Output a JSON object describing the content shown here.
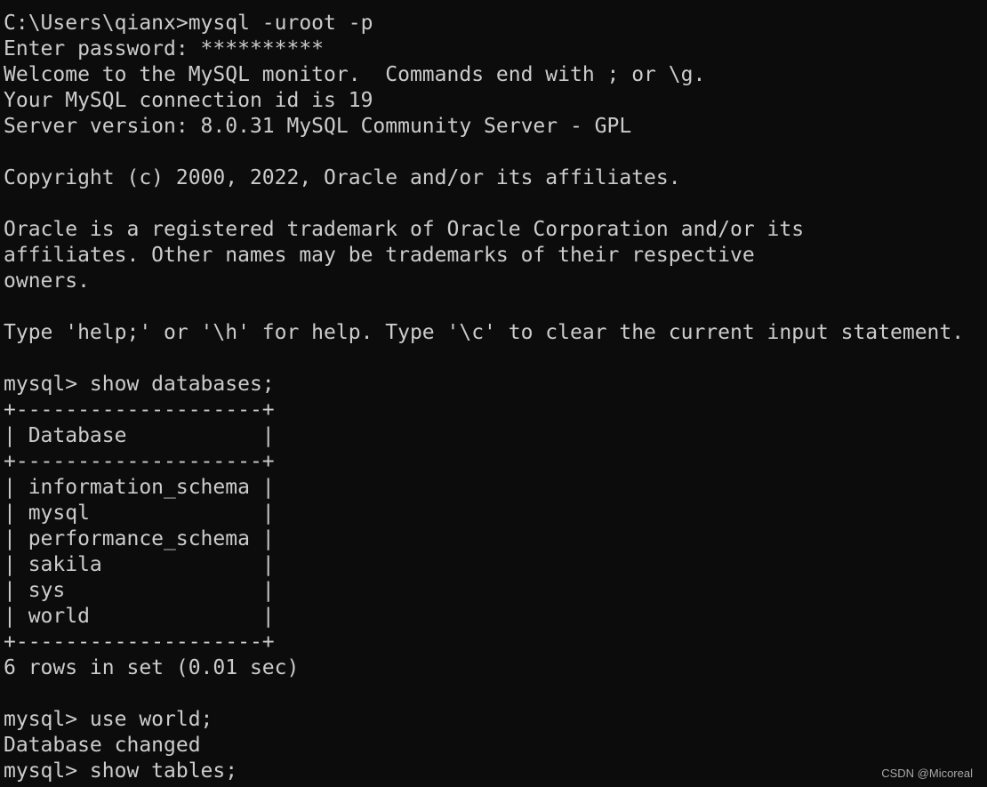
{
  "terminal": {
    "background": "#0c0c0c",
    "foreground": "#cccccc",
    "lines": [
      "C:\\Users\\qianx>mysql -uroot -p",
      "Enter password: **********",
      "Welcome to the MySQL monitor.  Commands end with ; or \\g.",
      "Your MySQL connection id is 19",
      "Server version: 8.0.31 MySQL Community Server - GPL",
      "",
      "Copyright (c) 2000, 2022, Oracle and/or its affiliates.",
      "",
      "Oracle is a registered trademark of Oracle Corporation and/or its",
      "affiliates. Other names may be trademarks of their respective",
      "owners.",
      "",
      "Type 'help;' or '\\h' for help. Type '\\c' to clear the current input statement.",
      "",
      "mysql> show databases;",
      "+--------------------+",
      "| Database           |",
      "+--------------------+",
      "| information_schema |",
      "| mysql              |",
      "| performance_schema |",
      "| sakila             |",
      "| sys                |",
      "| world              |",
      "+--------------------+",
      "6 rows in set (0.01 sec)",
      "",
      "mysql> use world;",
      "Database changed",
      "mysql> show tables;"
    ]
  },
  "watermark": "CSDN @Micoreal"
}
